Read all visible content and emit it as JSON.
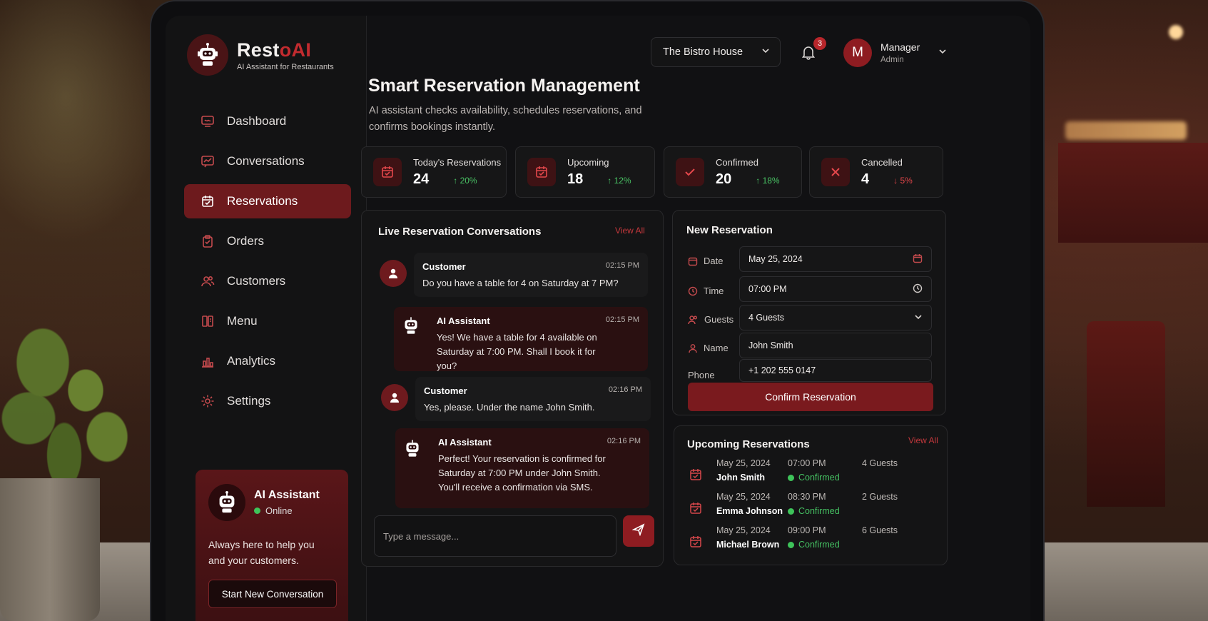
{
  "brand": {
    "name_prefix": "Rest",
    "name_accent": "oAI",
    "tagline": "AI Assistant for Restaurants"
  },
  "nav": {
    "items": [
      {
        "label": "Dashboard",
        "icon": "chat-monitor-icon"
      },
      {
        "label": "Conversations",
        "icon": "chat-trend-icon"
      },
      {
        "label": "Reservations",
        "icon": "calendar-icon",
        "active": true
      },
      {
        "label": "Orders",
        "icon": "clipboard-icon"
      },
      {
        "label": "Customers",
        "icon": "users-icon"
      },
      {
        "label": "Menu",
        "icon": "book-icon"
      },
      {
        "label": "Analytics",
        "icon": "bar-chart-icon"
      },
      {
        "label": "Settings",
        "icon": "gear-icon"
      }
    ]
  },
  "assistant_card": {
    "title": "AI Assistant",
    "status": "Online",
    "text": "Always here to help you and your customers.",
    "button": "Start New Conversation"
  },
  "header": {
    "restaurant_select": "The Bistro House",
    "notifications": "3",
    "user_initial": "M",
    "user_name": "Manager",
    "user_role": "Admin"
  },
  "page": {
    "title": "Smart Reservation Management",
    "subtitle": "AI assistant checks availability, schedules reservations, and confirms bookings instantly."
  },
  "stats": [
    {
      "label": "Today's Reservations",
      "value": "24",
      "change": "↑ 20%",
      "trend": "up",
      "icon": "calendar-icon"
    },
    {
      "label": "Upcoming",
      "value": "18",
      "change": "↑ 12%",
      "trend": "up",
      "icon": "calendar-icon"
    },
    {
      "label": "Confirmed",
      "value": "20",
      "change": "↑ 18%",
      "trend": "up",
      "icon": "check-icon"
    },
    {
      "label": "Cancelled",
      "value": "4",
      "change": "↓ 5%",
      "trend": "down",
      "icon": "x-icon"
    }
  ],
  "conversations": {
    "title": "Live Reservation Conversations",
    "view_all": "View All",
    "messages": [
      {
        "sender": "Customer",
        "time": "02:15 PM",
        "text": "Do you have a table for 4 on Saturday at 7 PM?"
      },
      {
        "sender": "AI Assistant",
        "time": "02:15 PM",
        "text": "Yes! We have a table for 4 available on Saturday at 7:00 PM. Shall I book it for you?"
      },
      {
        "sender": "Customer",
        "time": "02:16 PM",
        "text": "Yes, please. Under the name John Smith."
      },
      {
        "sender": "AI Assistant",
        "time": "02:16 PM",
        "text": "Perfect! Your reservation is confirmed for Saturday at 7:00 PM under John Smith. You'll receive a confirmation via SMS."
      }
    ],
    "input_placeholder": "Type a message..."
  },
  "new_reservation": {
    "title": "New Reservation",
    "date_label": "Date",
    "date_value": "May 25, 2024",
    "time_label": "Time",
    "time_value": "07:00 PM",
    "guests_label": "Guests",
    "guests_value": "4 Guests",
    "name_label": "Name",
    "name_value": "John Smith",
    "phone_label": "Phone",
    "phone_value": "+1 202 555 0147",
    "button": "Confirm Reservation"
  },
  "upcoming": {
    "title": "Upcoming Reservations",
    "view_all": "View All",
    "rows": [
      {
        "date": "May 25, 2024",
        "name": "John Smith",
        "time": "07:00 PM",
        "status": "Confirmed",
        "guests": "4 Guests"
      },
      {
        "date": "May 25, 2024",
        "name": "Emma Johnson",
        "time": "08:30 PM",
        "status": "Confirmed",
        "guests": "2 Guests"
      },
      {
        "date": "May 25, 2024",
        "name": "Michael Brown",
        "time": "09:00 PM",
        "status": "Confirmed",
        "guests": "6 Guests"
      }
    ]
  },
  "colors": {
    "accent": "#8e1c21",
    "accent_bright": "#c22b2f",
    "success": "#45c062",
    "danger": "#e04549"
  }
}
